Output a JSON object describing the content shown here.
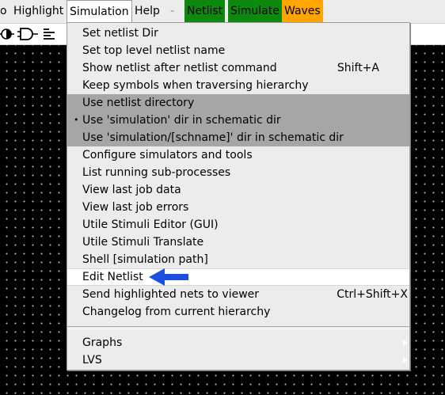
{
  "menubar": {
    "items": [
      "Highlight",
      "Simulation",
      "Help",
      "-",
      "Netlist",
      "Simulate",
      "Waves"
    ],
    "left_fragment": "o"
  },
  "simulation_menu": {
    "items": [
      {
        "label": "Set netlist Dir"
      },
      {
        "label": "Set top level netlist name"
      },
      {
        "label": "Show netlist after netlist command",
        "shortcut": "Shift+A"
      },
      {
        "label": "Keep symbols when traversing hierarchy"
      },
      {
        "label": "Use netlist directory"
      },
      {
        "label": "Use 'simulation' dir in schematic dir",
        "bullet": "•"
      },
      {
        "label": "Use 'simulation/[schname]' dir in schematic dir"
      },
      {
        "label": "Configure simulators and tools"
      },
      {
        "label": "List running sub-processes"
      },
      {
        "label": "View last job data"
      },
      {
        "label": "View last job errors"
      },
      {
        "label": "Utile Stimuli Editor (GUI)"
      },
      {
        "label": "Utile Stimuli Translate"
      },
      {
        "label": "Shell [simulation path]"
      },
      {
        "label": "Edit Netlist"
      },
      {
        "label": "Send highlighted nets to viewer",
        "shortcut": "Ctrl+Shift+X"
      },
      {
        "label": "Changelog from current hierarchy"
      },
      {
        "label": "Graphs"
      },
      {
        "label": "LVS"
      }
    ]
  },
  "colors": {
    "netlist_bg": "#0d8a0d",
    "simulate_bg": "#0d8a0d",
    "waves_bg": "#ffa500",
    "radio_group_bg": "#a6a6a6",
    "arrow_annotation": "#1a4fe0"
  },
  "icons": [
    "contrast-icon",
    "and-gate-icon",
    "align-left-icon",
    "arrow-left-icon",
    "submenu-arrow-icon"
  ]
}
